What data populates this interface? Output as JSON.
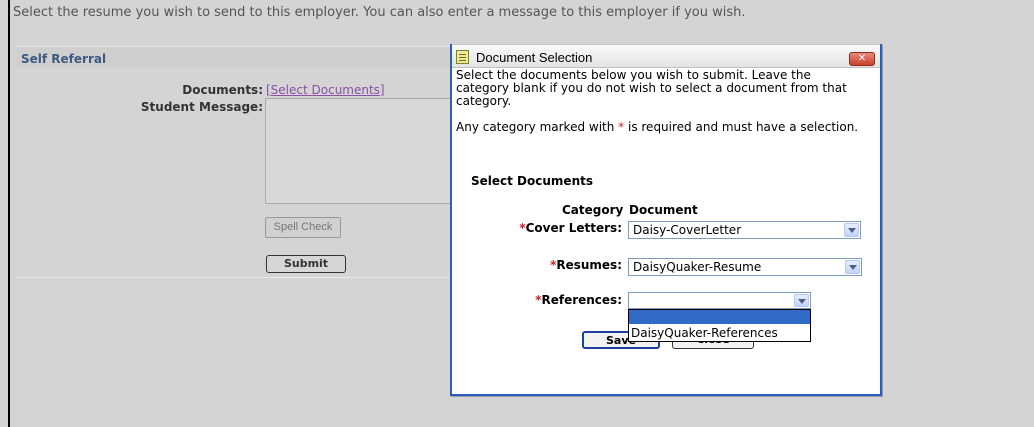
{
  "page": {
    "intro": "Select the resume you wish to send to this employer. You can also enter a message to this employer if you wish."
  },
  "referral": {
    "section_title": "Self Referral",
    "documents_label": "Documents:",
    "documents_link": "[Select Documents]",
    "message_label": "Student Message:",
    "message_value": "",
    "spell_check_label": "Spell Check",
    "submit_label": "Submit"
  },
  "dialog": {
    "title": "Document Selection",
    "close_glyph": "✕",
    "instructions_1": "Select the documents below you wish to submit.  Leave the category blank if you do not wish to select a document from that category.",
    "instructions_2_pre": "Any category marked with ",
    "required_star": "*",
    "instructions_2_post": " is required and must have a selection.",
    "select_heading": "Select Documents",
    "col_category": "Category",
    "col_document": "Document",
    "rows": [
      {
        "label": "Cover Letters:",
        "value": "Daisy-CoverLetter",
        "required": true
      },
      {
        "label": "Resumes:",
        "value": "DaisyQuaker-Resume",
        "required": true
      },
      {
        "label": "References:",
        "value": "",
        "required": true
      }
    ],
    "references_options": [
      "",
      "DaisyQuaker-References"
    ],
    "save_label": "Save",
    "close_label": "Close"
  },
  "colors": {
    "dialog_border": "#2a5fbf",
    "required": "#cc2020",
    "link": "#8a4fa8",
    "section_title": "#3d5a80",
    "selection_highlight": "#316ac5"
  },
  "icons": {
    "dialog_title_icon": "document-list-icon",
    "close_icon": "close-icon",
    "dropdown_arrow": "chevron-down-icon"
  }
}
